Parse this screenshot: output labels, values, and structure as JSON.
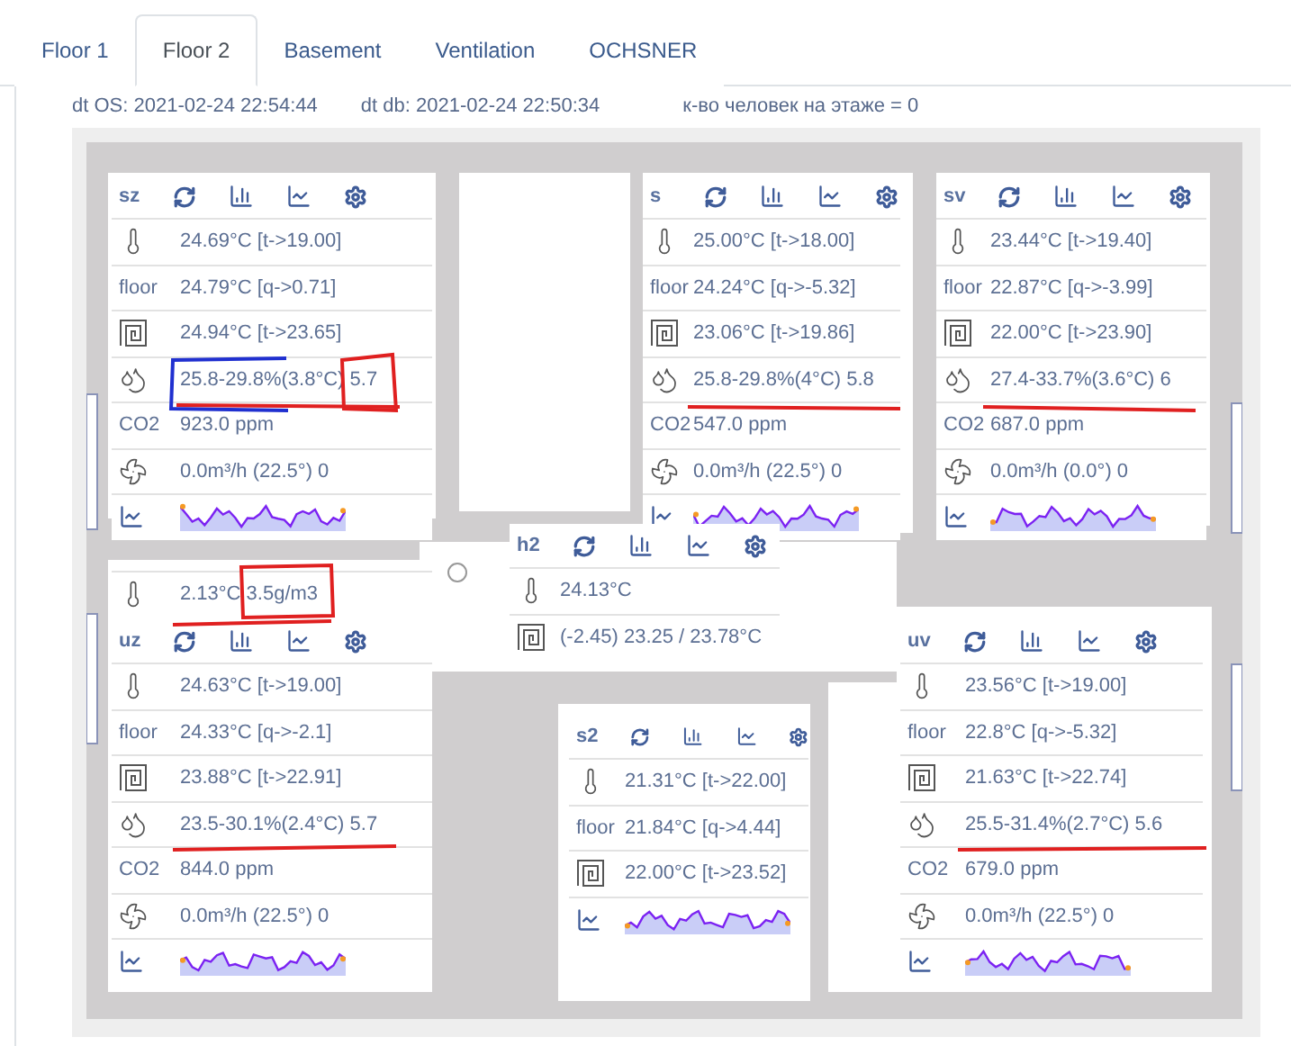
{
  "tabs": [
    {
      "label": "Floor 1",
      "selected": false
    },
    {
      "label": "Floor 2",
      "selected": true
    },
    {
      "label": "Basement",
      "selected": false
    },
    {
      "label": "Ventilation",
      "selected": false
    },
    {
      "label": "OCHSNER",
      "selected": false
    }
  ],
  "info": [
    "dt OS: 2021-02-24 22:54:44",
    "dt db: 2021-02-24 22:50:34",
    "к-во человек на этаже = 0"
  ],
  "rooms": [
    {
      "name": "sz",
      "rows": [
        {
          "kind": "temp",
          "value": "24.69°C [t->19.00]"
        },
        {
          "kind": "label",
          "label": "floor",
          "value": "24.79°C [q->0.71]"
        },
        {
          "kind": "heating",
          "value": "24.94°C [t->23.65]"
        },
        {
          "kind": "humidity",
          "value": "25.8-29.8%(3.8°C) 5.7"
        },
        {
          "kind": "label",
          "label": "CO2",
          "value": "923.0 ppm"
        },
        {
          "kind": "fan",
          "value": "0.0m³/h (22.5°) 0"
        },
        {
          "kind": "chart"
        }
      ]
    },
    {
      "name": "s",
      "rows": [
        {
          "kind": "temp",
          "value": "25.00°C [t->18.00]"
        },
        {
          "kind": "label",
          "label": "floor",
          "value": "24.24°C [q->-5.32]"
        },
        {
          "kind": "heating",
          "value": "23.06°C [t->19.86]"
        },
        {
          "kind": "humidity",
          "value": "25.8-29.8%(4°C) 5.8"
        },
        {
          "kind": "label",
          "label": "CO2",
          "value": "547.0 ppm"
        },
        {
          "kind": "fan",
          "value": "0.0m³/h (22.5°) 0"
        },
        {
          "kind": "chart"
        }
      ]
    },
    {
      "name": "sv",
      "rows": [
        {
          "kind": "temp",
          "value": "23.44°C [t->19.40]"
        },
        {
          "kind": "label",
          "label": "floor",
          "value": "22.87°C [q->-3.99]"
        },
        {
          "kind": "heating",
          "value": "22.00°C [t->23.90]"
        },
        {
          "kind": "humidity",
          "value": "27.4-33.7%(3.6°C) 6"
        },
        {
          "kind": "label",
          "label": "CO2",
          "value": "687.0 ppm"
        },
        {
          "kind": "fan",
          "value": "0.0m³/h (0.0°) 0"
        },
        {
          "kind": "chart"
        }
      ]
    },
    {
      "name": "h2",
      "rows": [
        {
          "kind": "temp",
          "value": "24.13°C"
        },
        {
          "kind": "heating",
          "value": "(-2.45) 23.25 / 23.78°C"
        }
      ]
    },
    {
      "name": "uz",
      "rows": [
        {
          "kind": "temp",
          "value": "24.63°C [t->19.00]"
        },
        {
          "kind": "label",
          "label": "floor",
          "value": "24.33°C [q->-2.1]"
        },
        {
          "kind": "heating",
          "value": "23.88°C [t->22.91]"
        },
        {
          "kind": "humidity",
          "value": "23.5-30.1%(2.4°C) 5.7"
        },
        {
          "kind": "label",
          "label": "CO2",
          "value": "844.0 ppm"
        },
        {
          "kind": "fan",
          "value": "0.0m³/h (22.5°) 0"
        },
        {
          "kind": "chart"
        }
      ]
    },
    {
      "name": "s2",
      "rows": [
        {
          "kind": "temp",
          "value": "21.31°C [t->22.00]"
        },
        {
          "kind": "label",
          "label": "floor",
          "value": "21.84°C [q->4.44]"
        },
        {
          "kind": "heating",
          "value": "22.00°C [t->23.52]"
        },
        {
          "kind": "chart"
        }
      ]
    },
    {
      "name": "uv",
      "rows": [
        {
          "kind": "temp",
          "value": "23.56°C [t->19.00]"
        },
        {
          "kind": "label",
          "label": "floor",
          "value": "22.8°C [q->-5.32]"
        },
        {
          "kind": "heating",
          "value": "21.63°C [t->22.74]"
        },
        {
          "kind": "humidity",
          "value": "25.5-31.4%(2.7°C) 5.6"
        },
        {
          "kind": "label",
          "label": "CO2",
          "value": "679.0 ppm"
        },
        {
          "kind": "fan",
          "value": "0.0m³/h (22.5°) 0"
        },
        {
          "kind": "chart"
        }
      ]
    }
  ],
  "outdoor": {
    "value": "2.13°C 3.5g/m3"
  }
}
